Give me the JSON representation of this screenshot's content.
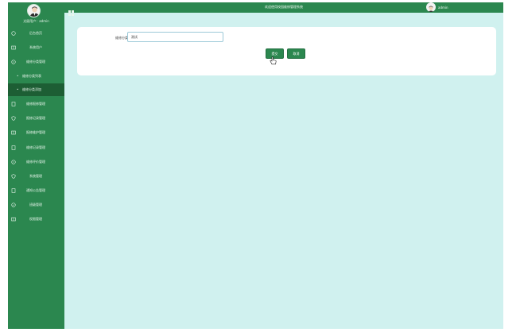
{
  "header": {
    "title": "欢迎使用校园维修管理系统",
    "username": "admin"
  },
  "sidebar": {
    "user_caption": "光顾用户：admin",
    "items": [
      {
        "label": "后台首页",
        "icon": "home-icon"
      },
      {
        "label": "系统用户",
        "icon": "book-icon"
      },
      {
        "label": "维修分类管理",
        "icon": "chat-icon"
      },
      {
        "label": "维修分类列表",
        "sub": true
      },
      {
        "label": "维修分类添加",
        "sub": true,
        "active": true
      },
      {
        "label": "维修报修管理",
        "icon": "doc-icon"
      },
      {
        "label": "报修记录管理",
        "icon": "shield-icon"
      },
      {
        "label": "报修维护管理",
        "icon": "book-icon"
      },
      {
        "label": "维修记录管理",
        "icon": "doc-icon"
      },
      {
        "label": "维修评价管理",
        "icon": "chat-icon"
      },
      {
        "label": "系统管理",
        "icon": "shield-icon"
      },
      {
        "label": "通知公告管理",
        "icon": "doc-icon"
      },
      {
        "label": "班级管理",
        "icon": "check-shield-icon"
      },
      {
        "label": "权限管理",
        "icon": "book-icon"
      }
    ]
  },
  "form": {
    "field_label": "维修分类",
    "field_value": "测试",
    "submit_label": "提交",
    "cancel_label": "取消"
  },
  "colors": {
    "primary": "#2b874f",
    "active": "#1d5e34",
    "background": "#d0f1ef"
  }
}
